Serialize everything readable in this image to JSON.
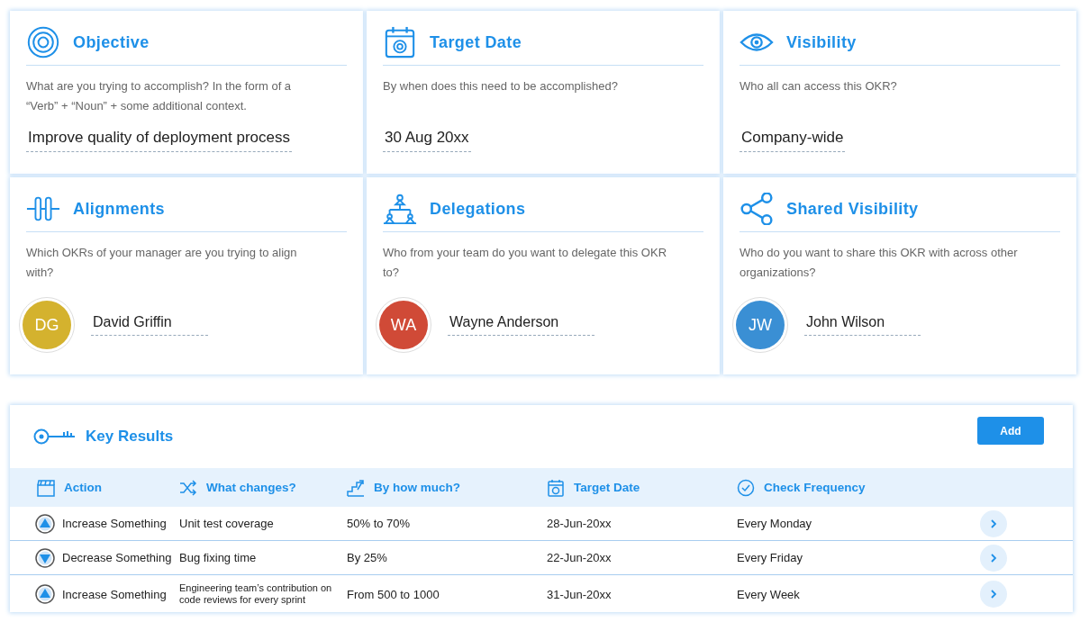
{
  "cards": [
    {
      "kind": "text",
      "title": "Objective",
      "question": "What are you trying to accomplish? In the form of a “Verb” + “Noun” + some additional context.",
      "value": "Improve quality of deployment process"
    },
    {
      "kind": "text",
      "title": "Target Date",
      "question": "By when does this need to be accomplished?",
      "value": "30 Aug 20xx"
    },
    {
      "kind": "text",
      "title": "Visibility",
      "question": "Who all can access this OKR?",
      "value": "Company-wide"
    },
    {
      "kind": "person",
      "title": "Alignments",
      "question": "Which OKRs of your manager are you trying to align with?",
      "initials": "DG",
      "color": "#d4b22e",
      "value": "David Griffin"
    },
    {
      "kind": "person",
      "title": "Delegations",
      "question": "Who from your team do you want to delegate this OKR to?",
      "initials": "WA",
      "color": "#d04a37",
      "value": "Wayne Anderson"
    },
    {
      "kind": "person",
      "title": "Shared Visibility",
      "question": "Who do you want to share this OKR with across other organizations?",
      "initials": "JW",
      "color": "#3a8fd4",
      "value": "John Wilson"
    }
  ],
  "key_results": {
    "title": "Key Results",
    "add_button": "Add",
    "columns": [
      "Action",
      "What changes?",
      "By how much?",
      "Target Date",
      "Check Frequency"
    ],
    "rows": [
      {
        "kind": "increase",
        "action": "Increase Something",
        "what": "Unit test coverage",
        "how_much": "50% to 70%",
        "date": "28-Jun-20xx",
        "frequency": "Every Monday"
      },
      {
        "kind": "decrease",
        "action": "Decrease Something",
        "what": "Bug fixing time",
        "how_much": "By 25%",
        "date": "22-Jun-20xx",
        "frequency": "Every Friday"
      },
      {
        "kind": "increase",
        "action": "Increase Something",
        "what": "Engineering team’s contribution on code reviews for every sprint",
        "how_much": "From 500 to 1000",
        "date": "31-Jun-20xx",
        "frequency": "Every Week"
      }
    ]
  }
}
